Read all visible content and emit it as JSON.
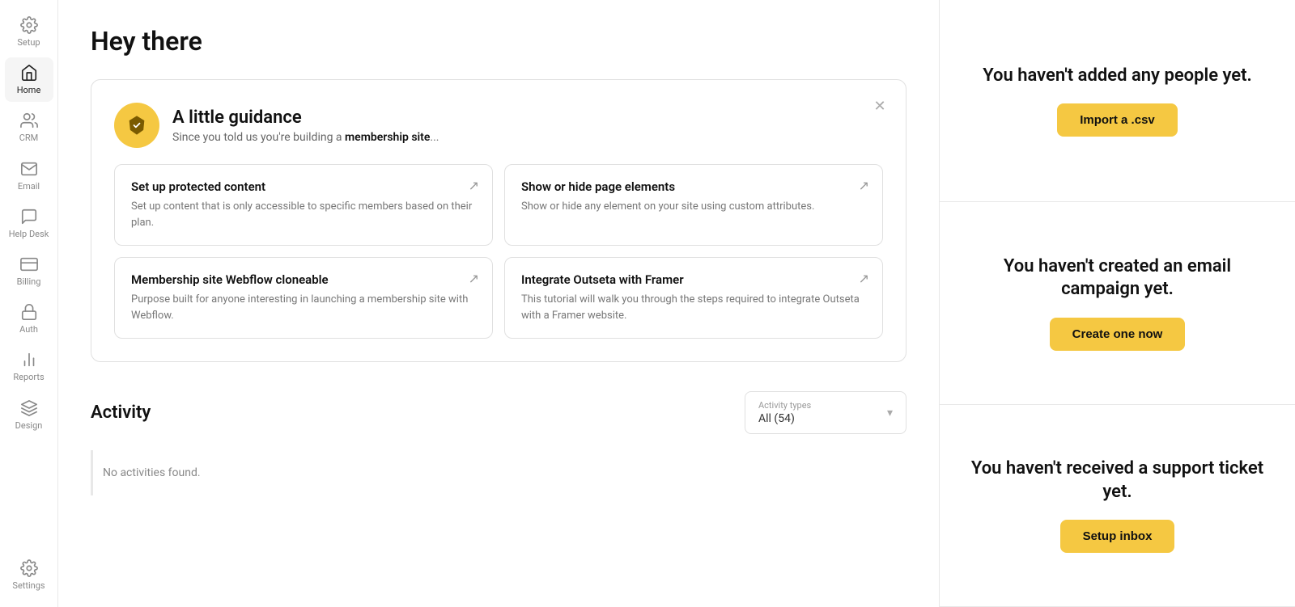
{
  "sidebar": {
    "items": [
      {
        "id": "setup",
        "label": "Setup",
        "icon": "setup"
      },
      {
        "id": "home",
        "label": "Home",
        "icon": "home",
        "active": true
      },
      {
        "id": "crm",
        "label": "CRM",
        "icon": "crm"
      },
      {
        "id": "email",
        "label": "Email",
        "icon": "email"
      },
      {
        "id": "helpdesk",
        "label": "Help Desk",
        "icon": "helpdesk"
      },
      {
        "id": "billing",
        "label": "Billing",
        "icon": "billing"
      },
      {
        "id": "auth",
        "label": "Auth",
        "icon": "auth"
      },
      {
        "id": "reports",
        "label": "Reports",
        "icon": "reports"
      },
      {
        "id": "design",
        "label": "Design",
        "icon": "design"
      },
      {
        "id": "settings",
        "label": "Settings",
        "icon": "settings"
      }
    ]
  },
  "page": {
    "title": "Hey there"
  },
  "guidance": {
    "title": "A little guidance",
    "subtitle_prefix": "Since you told us you're building a ",
    "subtitle_bold": "membership site",
    "subtitle_suffix": "...",
    "tiles": [
      {
        "id": "protected-content",
        "title": "Set up protected content",
        "desc": "Set up content that is only accessible to specific members based on their plan."
      },
      {
        "id": "show-hide-elements",
        "title": "Show or hide page elements",
        "desc": "Show or hide any element on your site using custom attributes."
      },
      {
        "id": "webflow-cloneable",
        "title": "Membership site Webflow cloneable",
        "desc": "Purpose built for anyone interesting in launching a membership site with Webflow."
      },
      {
        "id": "framer-integration",
        "title": "Integrate Outseta with Framer",
        "desc": "This tutorial will walk you through the steps required to integrate Outseta with a Framer website."
      }
    ]
  },
  "activity": {
    "title": "Activity",
    "empty_message": "No activities found.",
    "filter": {
      "label": "Activity types",
      "value": "All (54)"
    }
  },
  "right_panel": {
    "sections": [
      {
        "id": "people",
        "title": "You haven't added any people yet.",
        "button_label": "Import a .csv"
      },
      {
        "id": "email_campaign",
        "title": "You haven't created an email campaign yet.",
        "button_label": "Create one now"
      },
      {
        "id": "support_ticket",
        "title": "You haven't received a support ticket yet.",
        "button_label": "Setup inbox"
      }
    ]
  }
}
